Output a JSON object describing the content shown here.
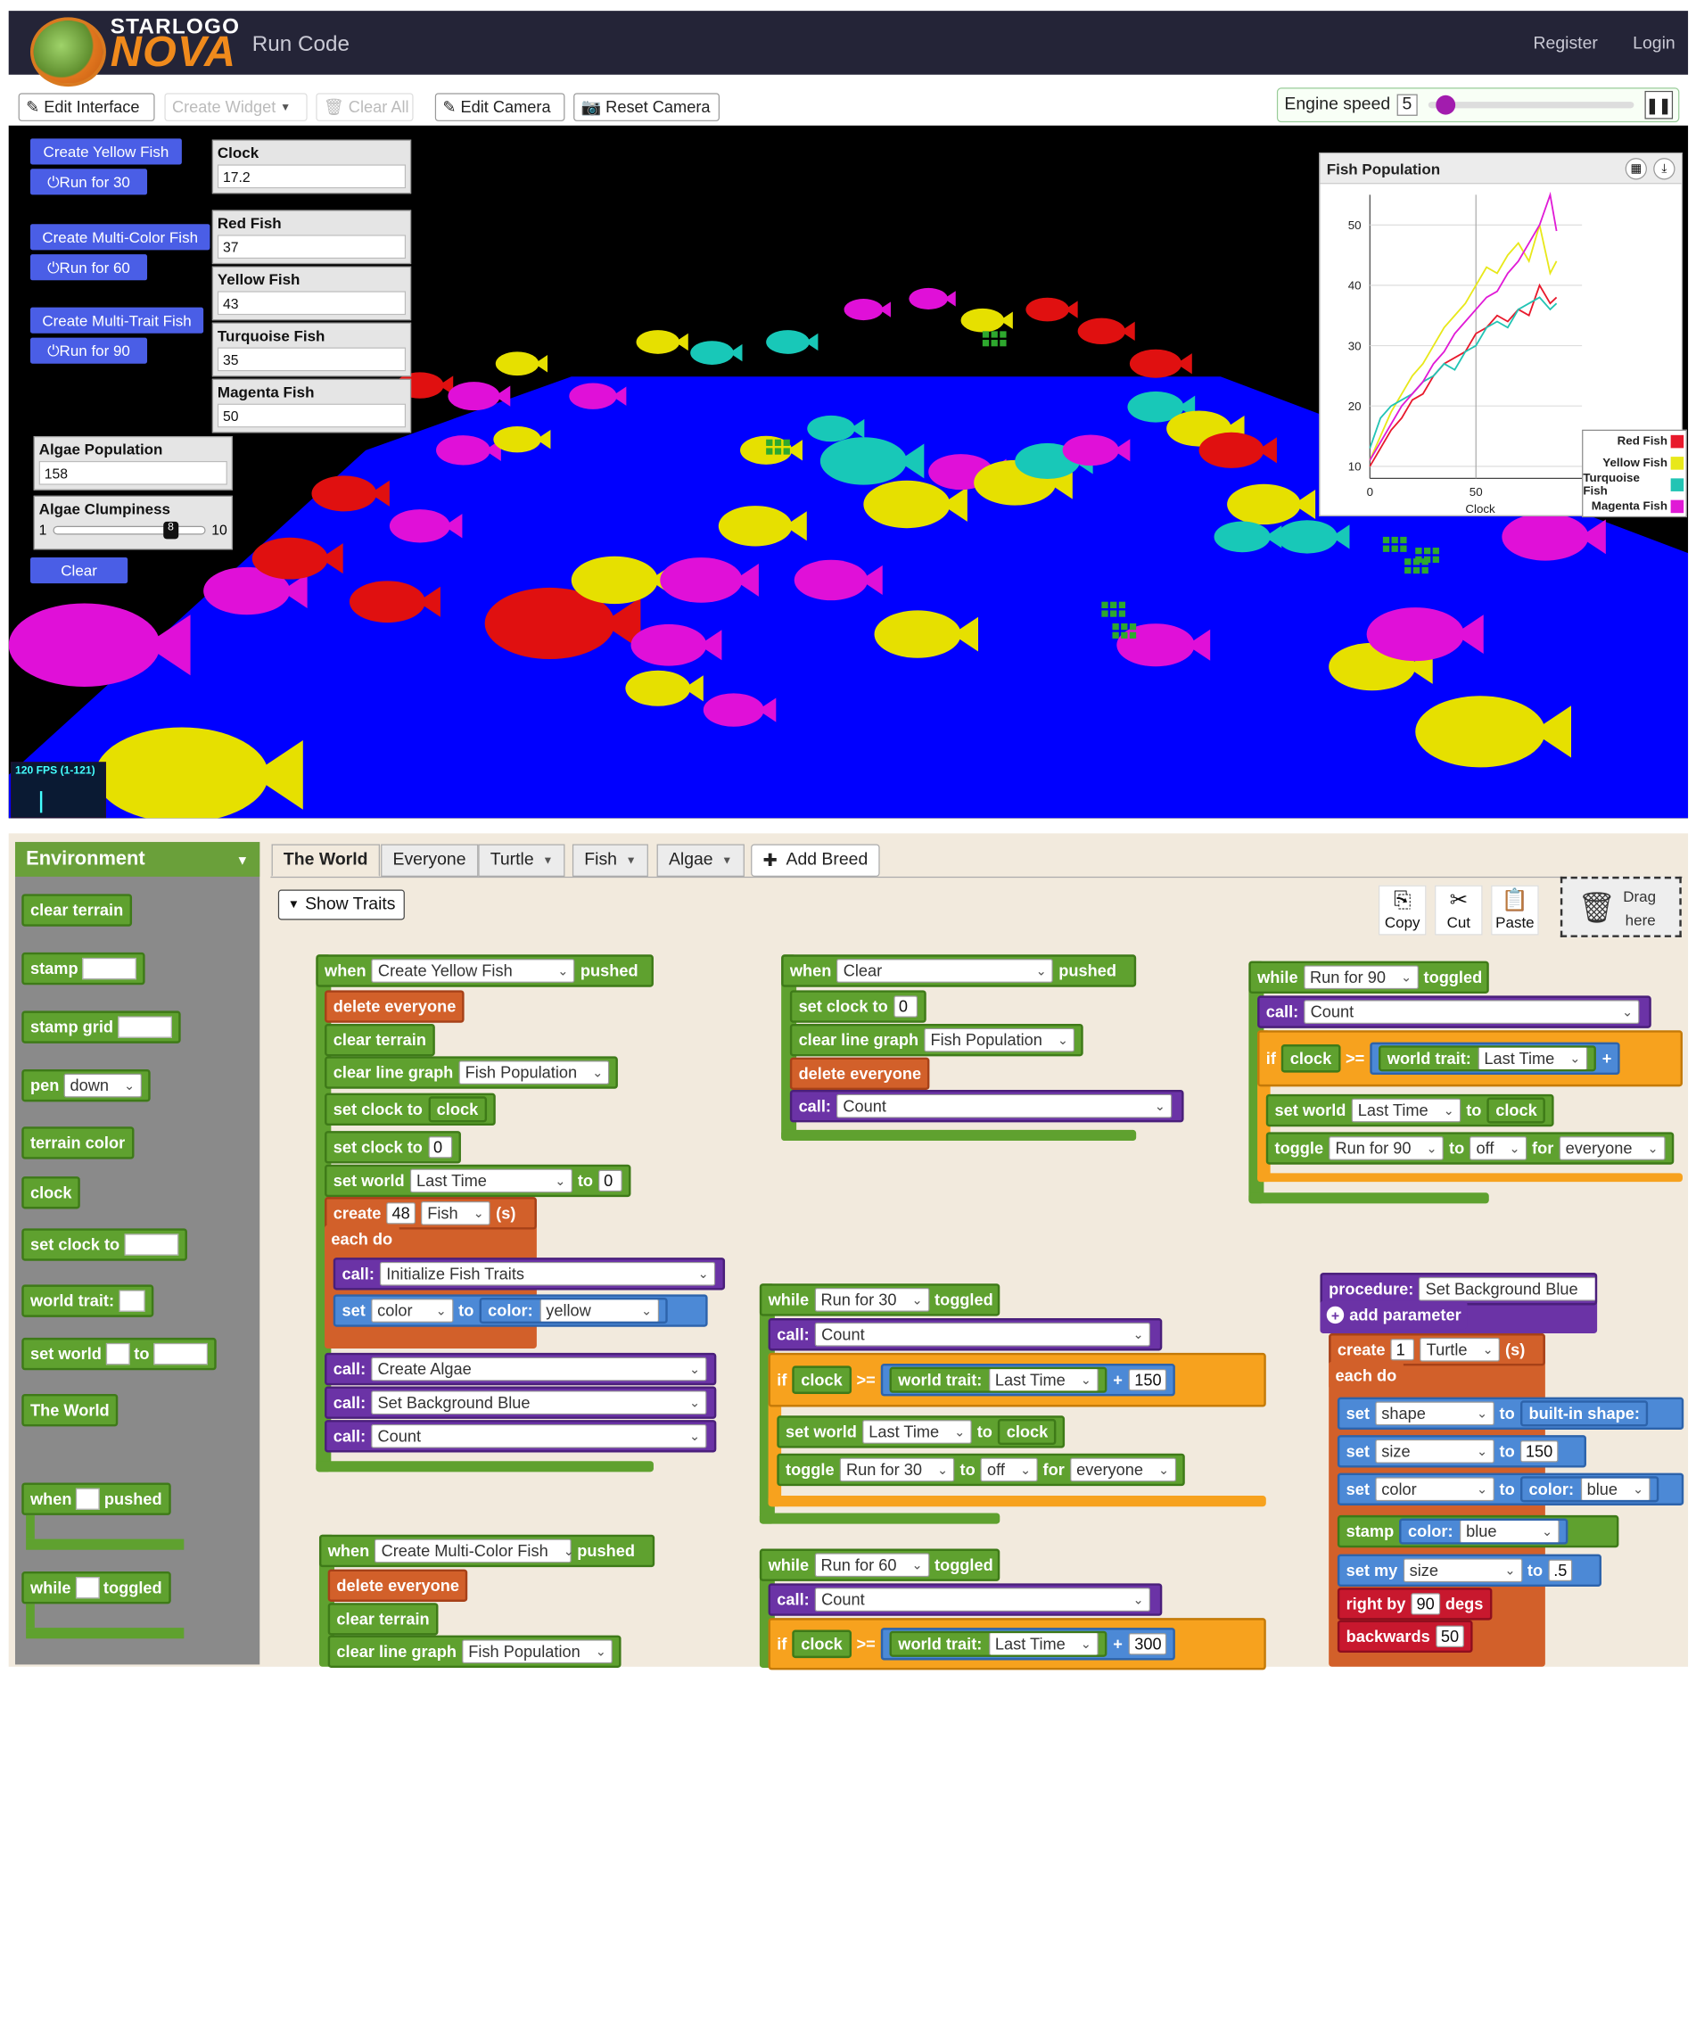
{
  "header": {
    "logo_top": "STARLOGO",
    "logo_bottom": "NOVA",
    "page_title": "Run Code",
    "register": "Register",
    "login": "Login"
  },
  "toolbar": {
    "edit_interface": "Edit Interface",
    "create_widget": "Create Widget",
    "clear_all": "Clear All",
    "edit_camera": "Edit Camera",
    "reset_camera": "Reset Camera",
    "engine_speed_label": "Engine speed",
    "engine_speed_value": "5",
    "engine_speed_fraction": 0.07
  },
  "widgets": {
    "buttons": [
      "Create Yellow Fish",
      "Run for 30",
      "Create Multi-Color Fish",
      "Run for 60",
      "Create Multi-Trait Fish",
      "Run for 90",
      "Clear"
    ],
    "monitors": [
      {
        "label": "Clock",
        "value": "17.2"
      },
      {
        "label": "Red Fish",
        "value": "37"
      },
      {
        "label": "Yellow Fish",
        "value": "43"
      },
      {
        "label": "Turquoise Fish",
        "value": "35"
      },
      {
        "label": "Magenta Fish",
        "value": "50"
      },
      {
        "label": "Algae Population",
        "value": "158"
      }
    ],
    "slider": {
      "label": "Algae Clumpiness",
      "min": "1",
      "max": "10",
      "value": "8"
    },
    "fps": "120 FPS (1-121)"
  },
  "chart_data": {
    "type": "line",
    "title": "Fish Population",
    "xlabel": "Clock",
    "ylabel": "",
    "xlim": [
      0,
      100
    ],
    "ylim": [
      8,
      55
    ],
    "xticks": [
      "0",
      "50"
    ],
    "yticks": [
      "10",
      "20",
      "30",
      "40",
      "50"
    ],
    "grid": true,
    "legend_position": "bottom-right",
    "series": [
      {
        "name": "Red Fish",
        "color": "#e8192c",
        "x": [
          0,
          5,
          10,
          15,
          20,
          25,
          30,
          35,
          40,
          45,
          50,
          55,
          60,
          65,
          70,
          75,
          80,
          85,
          88
        ],
        "y": [
          10,
          13,
          16,
          18,
          21,
          22,
          25,
          27,
          28,
          29,
          32,
          33,
          35,
          34,
          36,
          35,
          40,
          37,
          38
        ]
      },
      {
        "name": "Yellow Fish",
        "color": "#e8e81a",
        "x": [
          0,
          5,
          10,
          15,
          20,
          25,
          30,
          35,
          40,
          45,
          50,
          55,
          60,
          65,
          70,
          75,
          80,
          85,
          88
        ],
        "y": [
          11,
          15,
          19,
          22,
          25,
          27,
          30,
          33,
          35,
          37,
          40,
          43,
          42,
          45,
          47,
          44,
          50,
          42,
          44
        ]
      },
      {
        "name": "Turquoise Fish",
        "color": "#22c4b4",
        "x": [
          0,
          5,
          10,
          15,
          20,
          25,
          30,
          35,
          40,
          45,
          50,
          55,
          60,
          65,
          70,
          75,
          80,
          85,
          88
        ],
        "y": [
          13,
          18,
          20,
          21,
          22,
          24,
          25,
          27,
          26,
          29,
          30,
          33,
          34,
          33,
          36,
          37,
          38,
          36,
          37
        ]
      },
      {
        "name": "Magenta Fish",
        "color": "#e01ad6",
        "x": [
          0,
          5,
          10,
          15,
          20,
          25,
          30,
          35,
          40,
          45,
          50,
          55,
          60,
          65,
          70,
          75,
          80,
          85,
          88
        ],
        "y": [
          11,
          14,
          17,
          20,
          22,
          24,
          27,
          29,
          32,
          34,
          36,
          38,
          39,
          42,
          44,
          47,
          50,
          55,
          49
        ]
      }
    ]
  },
  "palette": {
    "header": "Environment",
    "blocks": [
      "clear terrain",
      "stamp",
      "stamp grid",
      "pen",
      "down",
      "terrain color",
      "clock",
      "set clock to",
      "world trait:",
      "set world",
      "to",
      "The World",
      "when",
      "pushed",
      "while",
      "toggled"
    ]
  },
  "tabs": [
    "The World",
    "Everyone",
    "Turtle",
    "Fish",
    "Algae",
    "Add Breed"
  ],
  "editor": {
    "show_traits": "Show Traits",
    "copy": "Copy",
    "cut": "Cut",
    "paste": "Paste",
    "drag": "Drag",
    "here": "here"
  },
  "code": {
    "w1": [
      "when",
      "Create Yellow Fish",
      "pushed"
    ],
    "c1": [
      "delete everyone",
      "clear terrain",
      "clear line graph",
      "Fish Population",
      "set clock to",
      "clock",
      "set clock to",
      "0",
      "set world",
      "Last Time",
      "to",
      "0",
      "create",
      "48",
      "Fish",
      "(s)",
      "each do",
      "call:",
      "Initialize Fish Traits",
      "set",
      "color",
      "to",
      "color:",
      "yellow",
      "call:",
      "Create Algae",
      "call:",
      "Set Background Blue",
      "call:",
      "Count"
    ],
    "w2": [
      "when",
      "Create Multi-Color Fish",
      "pushed"
    ],
    "c2": [
      "delete everyone",
      "clear terrain",
      "clear line graph",
      "Fish Population"
    ],
    "w3": [
      "when",
      "Clear",
      "pushed"
    ],
    "c3": [
      "set clock to",
      "0",
      "clear line graph",
      "Fish Population",
      "delete everyone",
      "call:",
      "Count"
    ],
    "w4": [
      "while",
      "Run for 30",
      "toggled"
    ],
    "c4": [
      "call:",
      "Count",
      "if",
      "clock",
      ">=",
      "world trait:",
      "Last Time",
      "+",
      "150",
      "set world",
      "Last Time",
      "to",
      "clock",
      "toggle",
      "Run for 30",
      "to",
      "off",
      "for",
      "everyone"
    ],
    "w5": [
      "while",
      "Run for 60",
      "toggled"
    ],
    "c5": [
      "call:",
      "Count",
      "if",
      "clock",
      ">=",
      "world trait:",
      "Last Time",
      "+",
      "300"
    ],
    "w6": [
      "while",
      "Run for 90",
      "toggled"
    ],
    "c6": [
      "call:",
      "Count",
      "if",
      "clock",
      ">=",
      "world trait:",
      "Last Time",
      "+",
      "set world",
      "Last Time",
      "to",
      "clock",
      "toggle",
      "Run for 90",
      "to",
      "off",
      "for",
      "everyone"
    ],
    "proc": [
      "procedure:",
      "Set Background Blue",
      "add parameter",
      "create",
      "1",
      "Turtle",
      "(s)",
      "each do",
      "set",
      "shape",
      "to",
      "built-in shape:",
      "set",
      "size",
      "to",
      "150",
      "set",
      "color",
      "to",
      "color:",
      "blue",
      "stamp",
      "color:",
      "blue",
      "set my",
      "size",
      "to",
      ".5",
      "right by",
      "90",
      "degs",
      "backwards",
      "50"
    ]
  },
  "colors": {
    "header_bg": "#242437",
    "water": "#0000ff",
    "ground": "#000000",
    "button_blue": "#4a5ee6",
    "editor_bg": "#f2eadd"
  }
}
